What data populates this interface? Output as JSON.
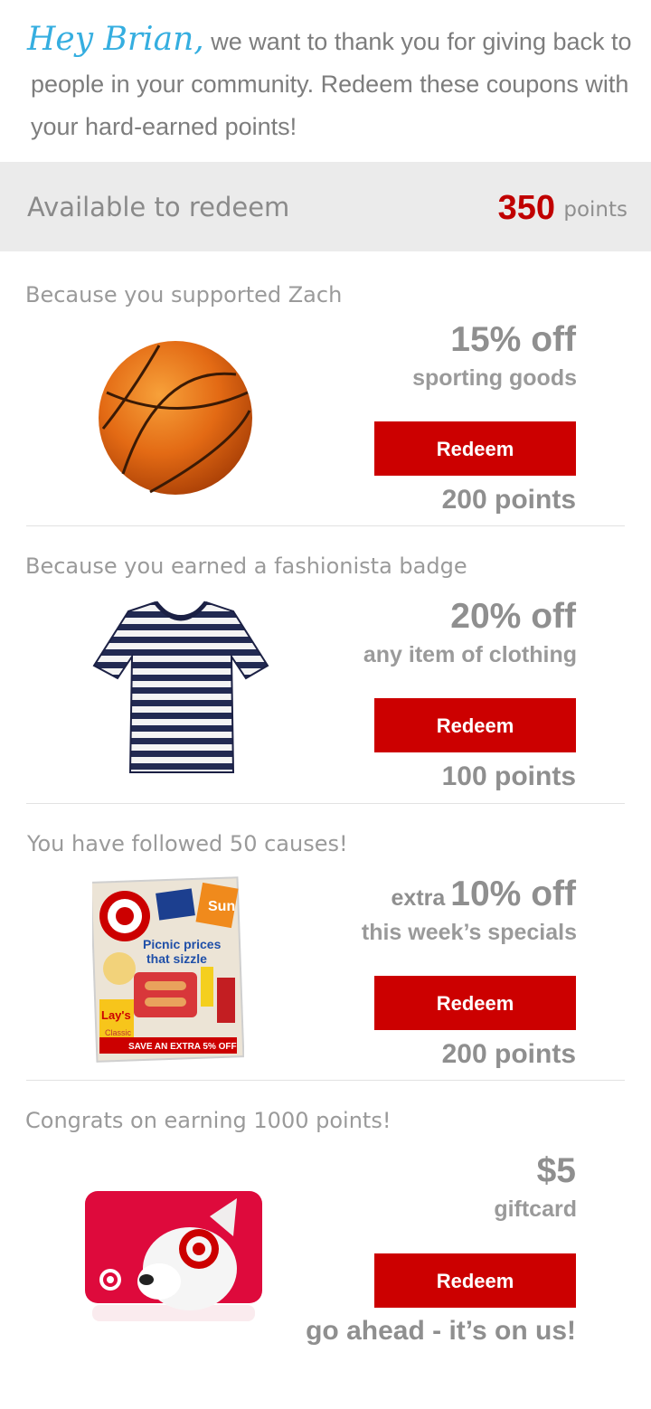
{
  "intro": {
    "greeting": "Hey Brian,",
    "message": " we want to thank you for giving back to people in your community.  Redeem these coupons with your hard-earned points!"
  },
  "balance": {
    "label": "Available to redeem",
    "points": "350",
    "unit": "points"
  },
  "offers": [
    {
      "reason": "Because you supported Zach",
      "prefix": "",
      "headline": "15% off",
      "subtitle": "sporting goods",
      "button_label": "Redeem",
      "cost": "200 points",
      "image": "basketball-icon"
    },
    {
      "reason": "Because you earned a fashionista badge",
      "prefix": "",
      "headline": "20% off",
      "subtitle": "any item of clothing",
      "button_label": "Redeem",
      "cost": "100 points",
      "image": "striped-tshirt-icon"
    },
    {
      "reason": "You have followed 50 causes!",
      "prefix": "extra",
      "headline": "10% off",
      "subtitle": "this week’s specials",
      "button_label": "Redeem",
      "cost": "200 points",
      "image": "weekly-ad-flyer"
    },
    {
      "reason": "Congrats on earning 1000 points!",
      "prefix": "",
      "headline": "$5",
      "subtitle": "giftcard",
      "button_label": "Redeem",
      "cost": "go ahead - it’s on us!",
      "image": "giftcard-dog-icon"
    }
  ],
  "flyer": {
    "headline_line1": "Picnic prices",
    "headline_line2": "that sizzle",
    "chips_brand": "Lay's",
    "chips_variant": "Classic",
    "banner": "SAVE AN EXTRA 5% OFF",
    "soda_brand": "Sun"
  },
  "colors": {
    "accent_red": "#cc0000",
    "points_red": "#c00000",
    "greeting_blue": "#35aee0",
    "text_gray": "#8f8f8f",
    "bar_gray": "#ebebeb"
  }
}
